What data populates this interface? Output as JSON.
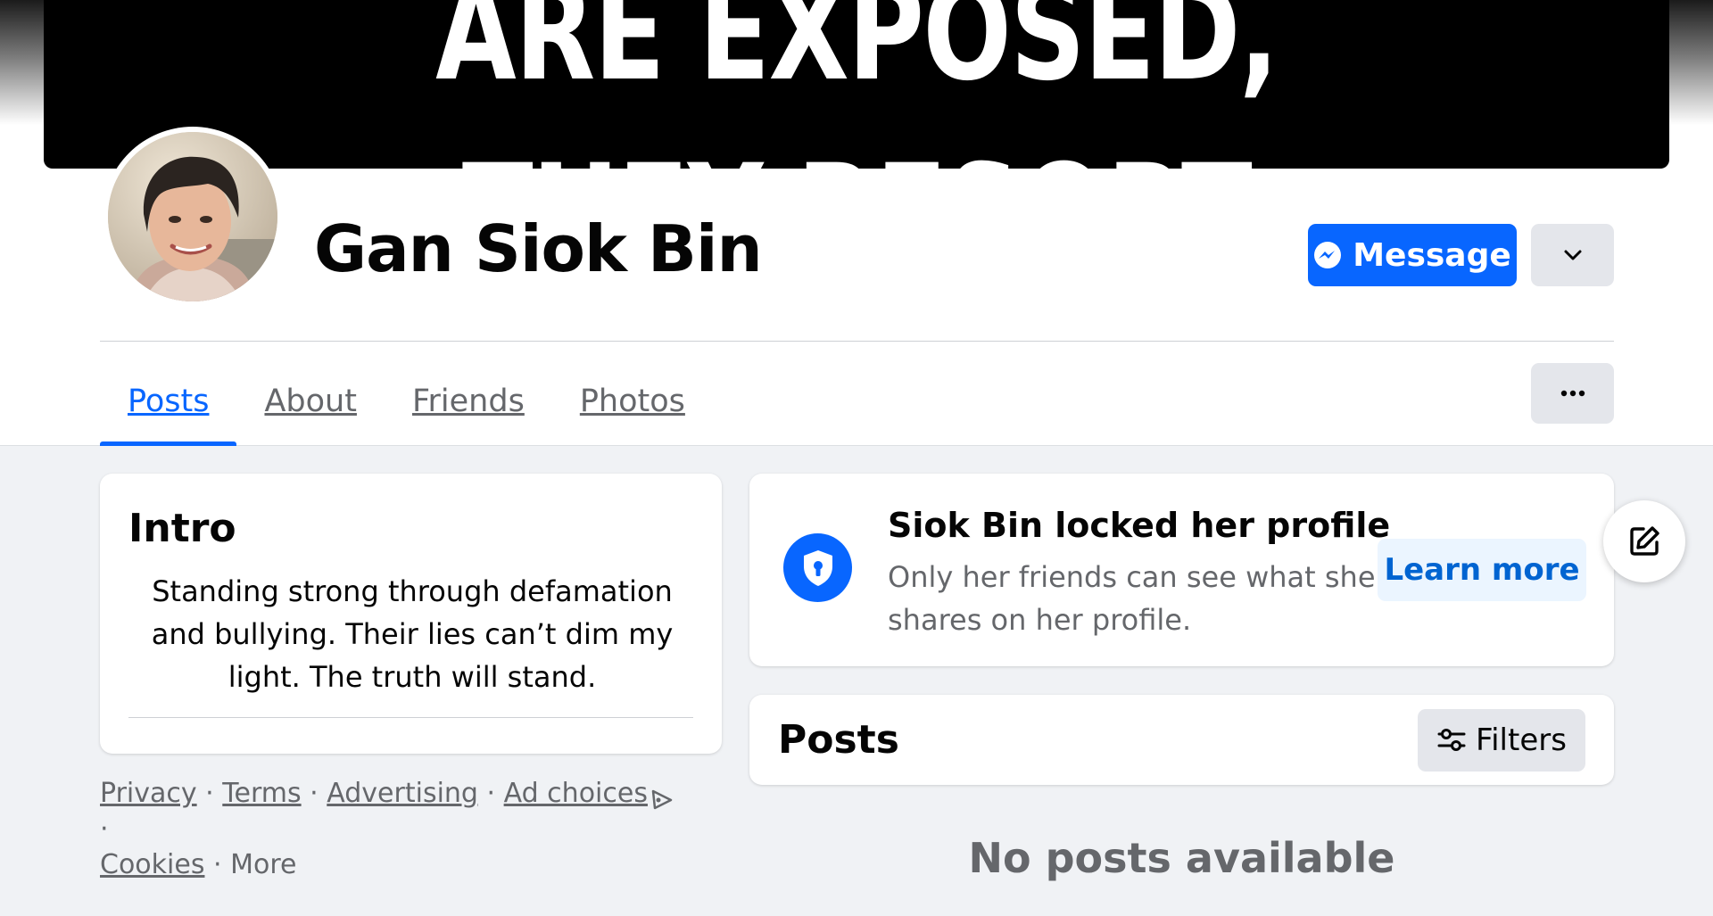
{
  "cover": {
    "line1": "ARE EXPOSED,",
    "line2": "THEY RESORT"
  },
  "profile": {
    "name": "Gan Siok Bin"
  },
  "actions": {
    "message_label": "Message",
    "dropdown_icon": "chevron-down-icon",
    "more_icon": "ellipsis-icon"
  },
  "tabs": [
    {
      "label": "Posts",
      "active": true
    },
    {
      "label": "About",
      "active": false
    },
    {
      "label": "Friends",
      "active": false
    },
    {
      "label": "Photos",
      "active": false
    }
  ],
  "intro": {
    "title": "Intro",
    "bio": "Standing strong through defamation and bullying. Their lies can’t dim my light. The truth will stand."
  },
  "footer": {
    "privacy": "Privacy",
    "terms": "Terms",
    "advertising": "Advertising",
    "ad_choices": "Ad choices",
    "cookies": "Cookies",
    "more": "More",
    "sep": "·"
  },
  "locked": {
    "title": "Siok Bin locked her profile",
    "description": "Only her friends can see what she shares on her profile.",
    "learn_more": "Learn more"
  },
  "posts": {
    "title": "Posts",
    "filters_label": "Filters",
    "empty_text": "No posts available"
  },
  "colors": {
    "brand_blue": "#0866ff",
    "page_bg": "#f0f2f5",
    "secondary_text": "#65676b",
    "button_gray": "#e4e6eb"
  }
}
